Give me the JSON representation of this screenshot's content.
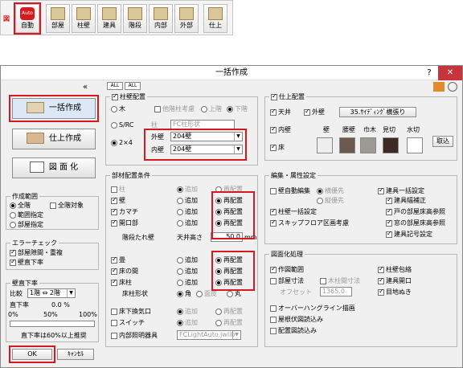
{
  "toolbar": {
    "zu_label": "図",
    "items": [
      {
        "label": "自動",
        "logo": "Auto"
      },
      {
        "label": "部屋"
      },
      {
        "label": "柱壁"
      },
      {
        "label": "建具"
      },
      {
        "label": "階段"
      },
      {
        "label": "内部"
      },
      {
        "label": "外部"
      },
      {
        "label": "仕上"
      }
    ]
  },
  "dialog": {
    "title": "一括作成",
    "help": "?",
    "close": "✕",
    "collapse": "«"
  },
  "left": {
    "btn_create": "一括作成",
    "btn_finish": "仕上作成",
    "btn_drawing": "図 面 化",
    "range": {
      "title": "作成範囲",
      "all_floors": "全階",
      "all_target": "全階対象",
      "range_spec": "範囲指定",
      "room_spec": "部屋指定"
    },
    "error": {
      "title": "エラーチェック",
      "room_gap": "部屋隙間・重複",
      "wall_straight": "壁直下率"
    },
    "wall_ratio": {
      "title": "壁直下率",
      "compare": "比較",
      "compare_value": "1階 ⇔ 2階",
      "ratio_label": "直下率",
      "ratio_value": "0.0 %",
      "tick0": "0%",
      "tick50": "50%",
      "tick100": "100%",
      "note": "直下率は60%以上推奨"
    },
    "ok": "OK",
    "cancel": "ｷｬﾝｾﾙ"
  },
  "pillar": {
    "title": "柱壁配置",
    "all": "ALL",
    "none": "ALL",
    "wood": "木",
    "wood_opts": [
      "他階柱考慮",
      "上階",
      "下階"
    ],
    "src": "S/RC",
    "src_col": "柱",
    "src_col_val": "FC柱形状",
    "two_by_four": "2×4",
    "ext_wall": "外壁",
    "ext_wall_val": "204壁",
    "int_wall": "内壁",
    "int_wall_val": "204壁"
  },
  "parts": {
    "title": "部材配置条件",
    "add": "追加",
    "replace": "再配置",
    "rows": [
      {
        "label": "柱",
        "on": false
      },
      {
        "label": "壁",
        "on": true
      },
      {
        "label": "カマチ",
        "on": true
      },
      {
        "label": "開口部",
        "on": true
      }
    ],
    "drop_wall": "階段たれ壁",
    "ceiling_h": "天井高さ",
    "ceiling_val": "50.0",
    "unit": "mm",
    "rows2": [
      {
        "label": "畳"
      },
      {
        "label": "床の間"
      },
      {
        "label": "床柱"
      }
    ],
    "column_shape": "床柱形状",
    "shape_opts": [
      "角",
      "面皮",
      "丸"
    ],
    "rows3": [
      {
        "label": "床下換気口"
      },
      {
        "label": "スイッチ"
      },
      {
        "label": "内部照明器具"
      }
    ],
    "light_val": "FCLightAuto.jwlib"
  },
  "finish": {
    "title": "仕上配置",
    "ceiling": "天井",
    "ext_wall": "外壁",
    "ext_val": "35.ｻｲﾃﾞｨﾝｸﾞ横張り",
    "int_wall": "内壁",
    "floor": "床",
    "cols": [
      "壁",
      "腰壁",
      "巾木",
      "見切",
      "水切"
    ],
    "take": "取込"
  },
  "edit": {
    "title": "編集・属性設定",
    "wall_auto": "壁自動編集",
    "horizontal": "横優先",
    "vertical": "縦優先",
    "bulk_fitting": "建具一括設定",
    "fitting_width": "建具幅補正",
    "door_floor": "戸の部屋床高参照",
    "window_floor": "窓の部屋床高参照",
    "fitting_symbol": "建具記号設定",
    "pillar_wall": "柱壁一括設定",
    "skip_floor": "スキップフロア区画考慮"
  },
  "drawing": {
    "title": "図面化処理",
    "create_range": "作図範囲",
    "pillar_pack": "柱壁包絡",
    "room_dim": "部屋寸法",
    "pillar_dim": "木柱間寸法",
    "offset": "オフセット",
    "offset_val": "1365.0",
    "fitting_opening": "建具開口",
    "eye": "目地ぬき",
    "overhang": "オーバーハングライン描画",
    "roof_plan": "屋根伏図読込み",
    "layout_plan": "配置図読込み"
  },
  "colors": {
    "highlight": "#d7191f",
    "accent": "#3d6fb6"
  }
}
